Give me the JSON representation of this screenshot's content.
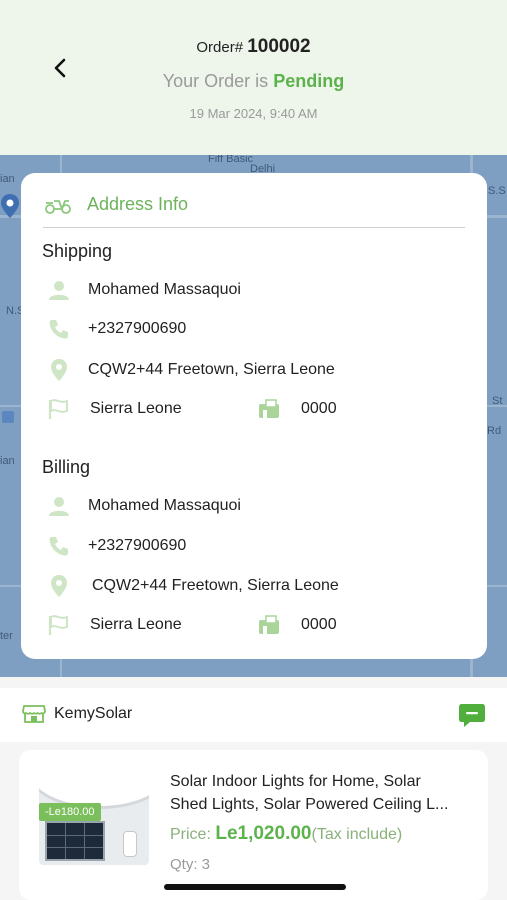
{
  "header": {
    "order_prefix": "Order# ",
    "order_number": "100002",
    "status_prefix": "Your Order is ",
    "status_value": "Pending",
    "date": "19 Mar 2024, 9:40 AM"
  },
  "map": {
    "labels": [
      "Fiff Basic",
      "Delhi",
      "ian",
      "N.S",
      "S.S",
      "ian",
      "Rd",
      "St",
      "ter"
    ]
  },
  "address_info": {
    "title": "Address Info",
    "shipping": {
      "heading": "Shipping",
      "name": "Mohamed Massaquoi",
      "phone": "+2327900690",
      "address": "CQW2+44 Freetown, Sierra Leone",
      "country": "Sierra Leone",
      "postal_code": "0000"
    },
    "billing": {
      "heading": "Billing",
      "name": "Mohamed Massaquoi",
      "phone": "+2327900690",
      "address": "CQW2+44 Freetown, Sierra Leone",
      "country": "Sierra Leone",
      "postal_code": "0000"
    }
  },
  "shop": {
    "name": "KemySolar"
  },
  "product": {
    "discount": "-Le180.00",
    "title_line1": "Solar Indoor Lights for Home, Solar",
    "title_line2": "Shed Lights, Solar Powered Ceiling L...",
    "price_label": "Price: ",
    "price": "Le1,020.00",
    "tax_note": "(Tax include)",
    "qty_label": "Qty: ",
    "qty": "3"
  },
  "colors": {
    "accent_green": "#5cb34c",
    "header_bg": "#eef5ea",
    "map_blue": "#7e9fc2"
  }
}
